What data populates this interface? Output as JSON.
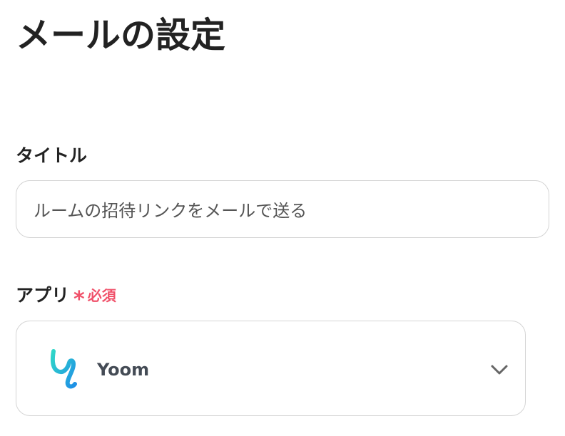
{
  "page": {
    "title": "メールの設定"
  },
  "title_field": {
    "label": "タイトル",
    "value": "ルームの招待リンクをメールで送る"
  },
  "app_field": {
    "label": "アプリ",
    "required_mark": "*",
    "required_text": "必須",
    "selected_app": "Yoom",
    "logo_icon": "yoom-logo-icon",
    "dropdown_icon": "chevron-down-icon"
  },
  "colors": {
    "required": "#f0516a",
    "logo_gradient_start": "#2fd6c8",
    "logo_gradient_end": "#1f8fe6"
  }
}
